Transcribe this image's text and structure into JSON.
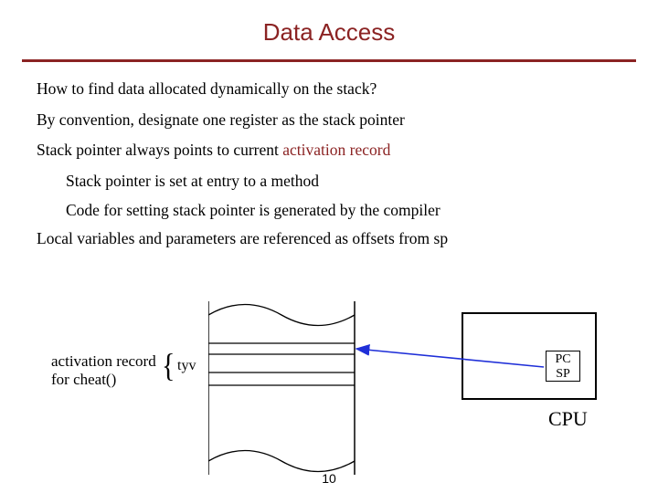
{
  "title": "Data Access",
  "lines": {
    "q": "How to find data allocated dynamically on the stack?",
    "conv": "By convention, designate one register as the stack pointer",
    "sp_points_pre": "Stack pointer always points to current ",
    "sp_points_accent": "activation record",
    "sub1": "Stack pointer is set at entry to a method",
    "sub2": "Code for setting stack pointer is generated by the compiler",
    "offsets": "Local variables and parameters are referenced as offsets from sp"
  },
  "diagram": {
    "ar_label_1": "activation record",
    "ar_label_2": "for cheat()",
    "field": "tyv",
    "reg1": "PC",
    "reg2": "SP",
    "cpu": "CPU"
  },
  "page_number": "10"
}
